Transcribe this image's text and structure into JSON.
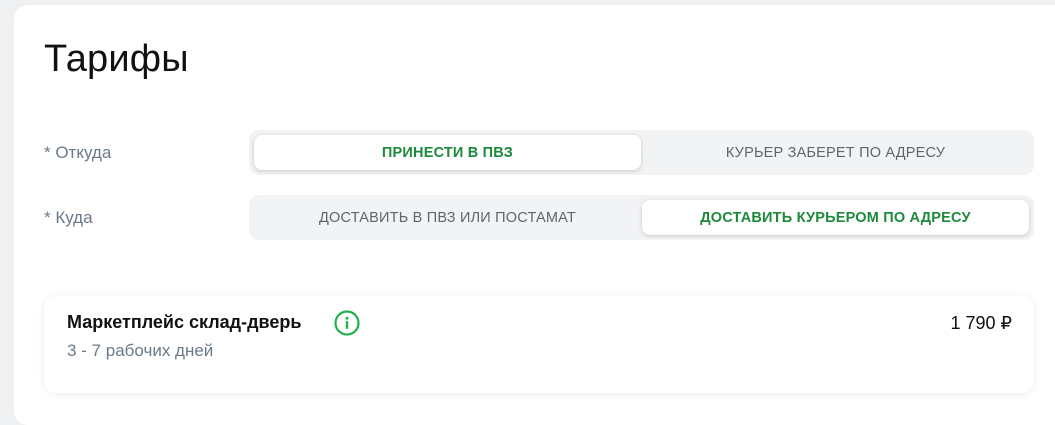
{
  "page": {
    "title": "Тарифы"
  },
  "from": {
    "label": "* Откуда",
    "options": [
      "ПРИНЕСТИ В ПВЗ",
      "КУРЬЕР ЗАБЕРЕТ ПО АДРЕСУ"
    ],
    "selected_index": 0
  },
  "to": {
    "label": "* Куда",
    "options": [
      "ДОСТАВИТЬ В ПВЗ ИЛИ ПОСТАМАТ",
      "ДОСТАВИТЬ КУРЬЕРОМ ПО АДРЕСУ"
    ],
    "selected_index": 1
  },
  "tariffs": [
    {
      "name": "Маркетплейс склад-дверь",
      "days": "3 - 7 рабочих дней",
      "price": "1 790 ₽",
      "icon": "info-icon"
    }
  ],
  "colors": {
    "accent": "#1c8a3a",
    "icon_accent": "#1fb14a"
  }
}
